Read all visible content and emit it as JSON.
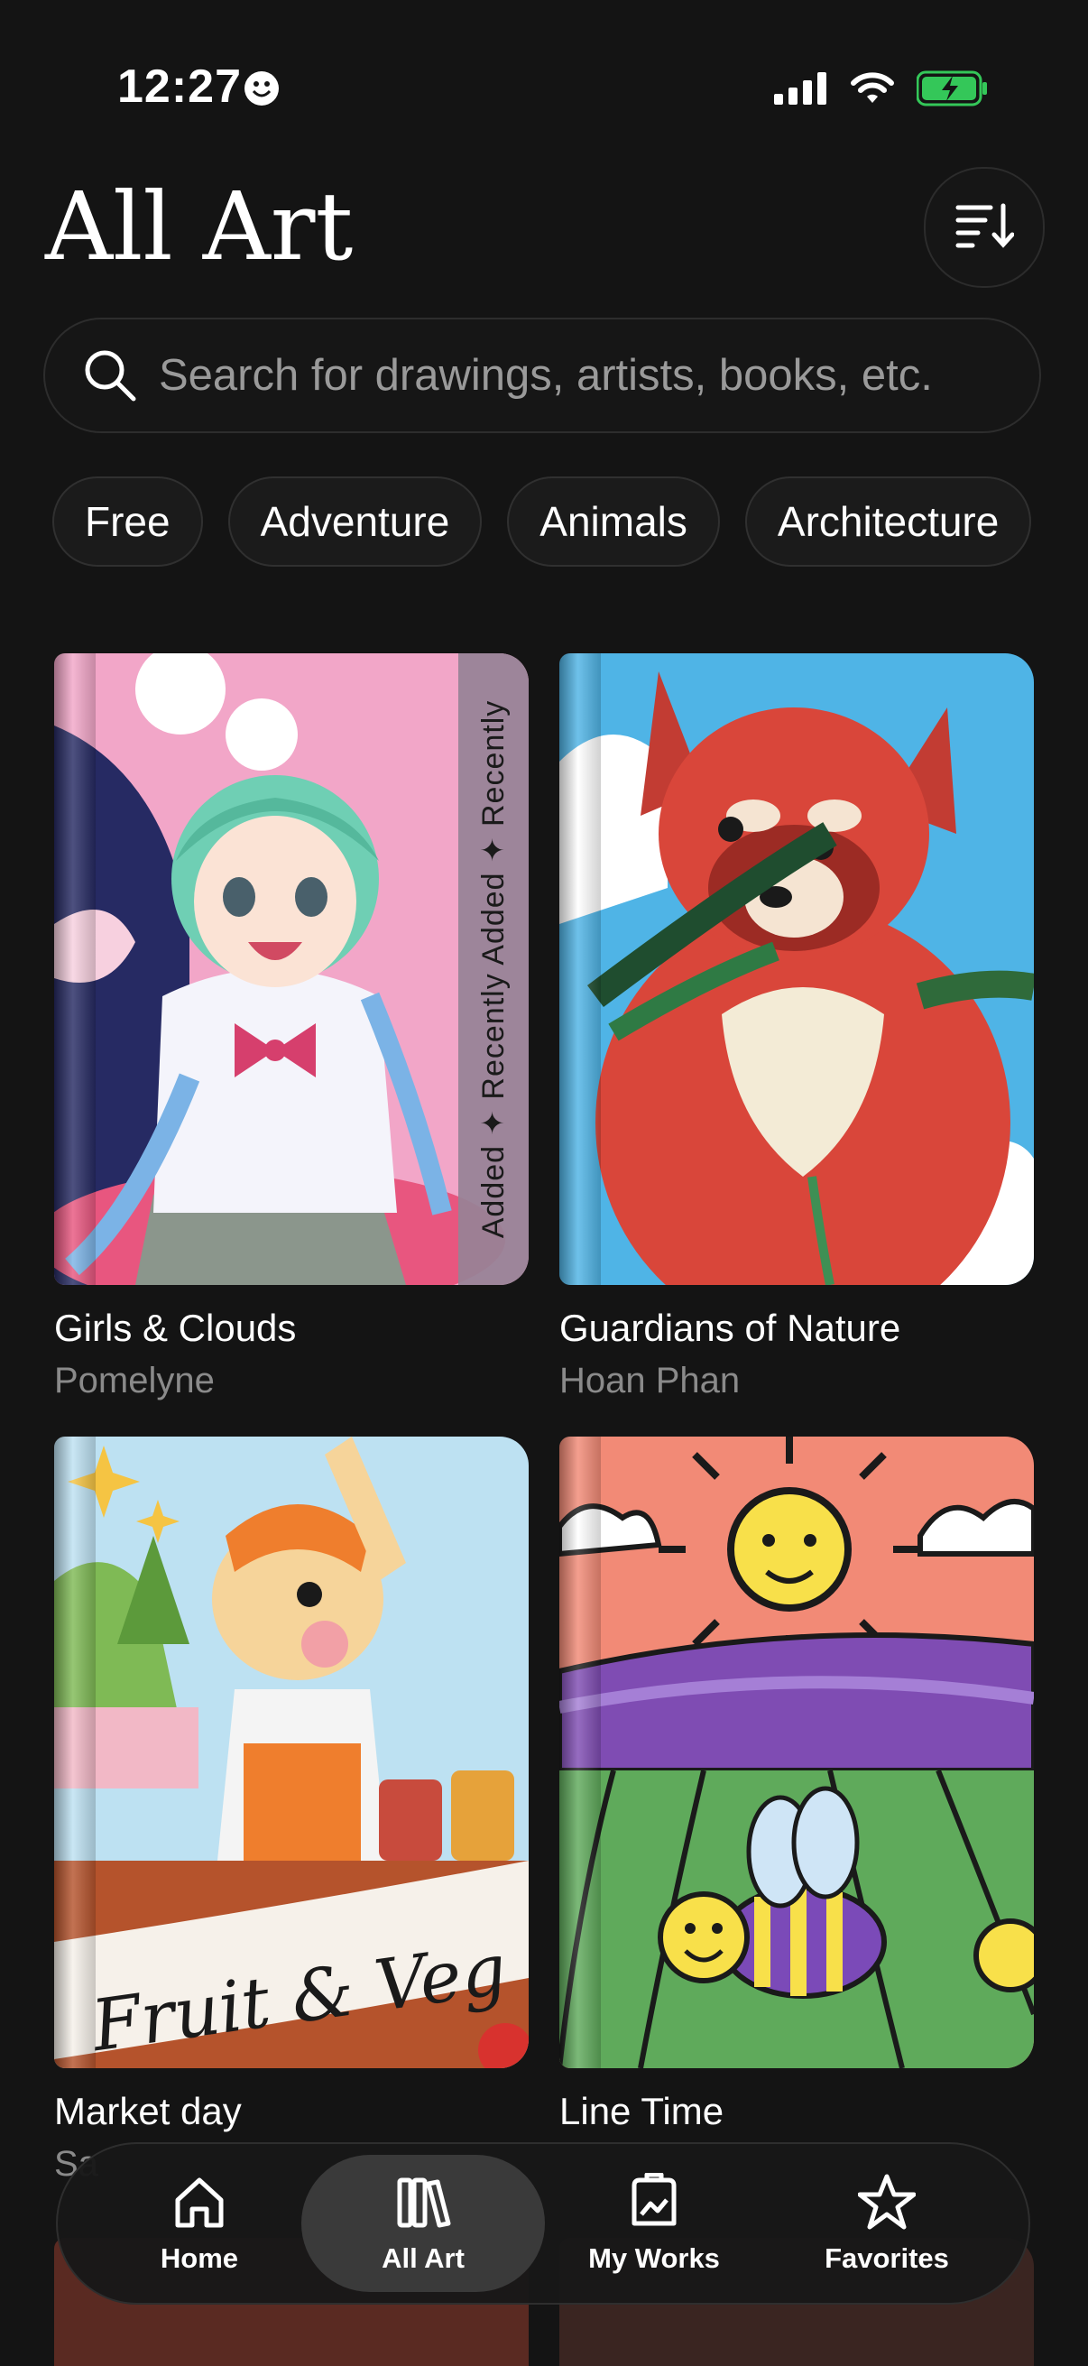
{
  "status_bar": {
    "time": "12:27"
  },
  "header": {
    "title": "All Art"
  },
  "search": {
    "placeholder": "Search for drawings, artists, books, etc."
  },
  "filters": [
    "Free",
    "Adventure",
    "Animals",
    "Architecture"
  ],
  "cards": [
    {
      "title": "Girls & Clouds",
      "artist": "Pomelyne",
      "ribbon": "Added ✦ Recently Added ✦ Recently"
    },
    {
      "title": "Guardians of Nature",
      "artist": "Hoan Phan"
    },
    {
      "title": "Market day",
      "artist": "Sa",
      "cover_text": "Fruit & Veg"
    },
    {
      "title": "Line Time",
      "artist": ""
    }
  ],
  "tabbar": {
    "home": "Home",
    "all_art": "All Art",
    "my_works": "My Works",
    "favorites": "Favorites"
  },
  "colors": {
    "background": "#141414",
    "active_tab": "#3a3a3a",
    "battery": "#34c759"
  }
}
